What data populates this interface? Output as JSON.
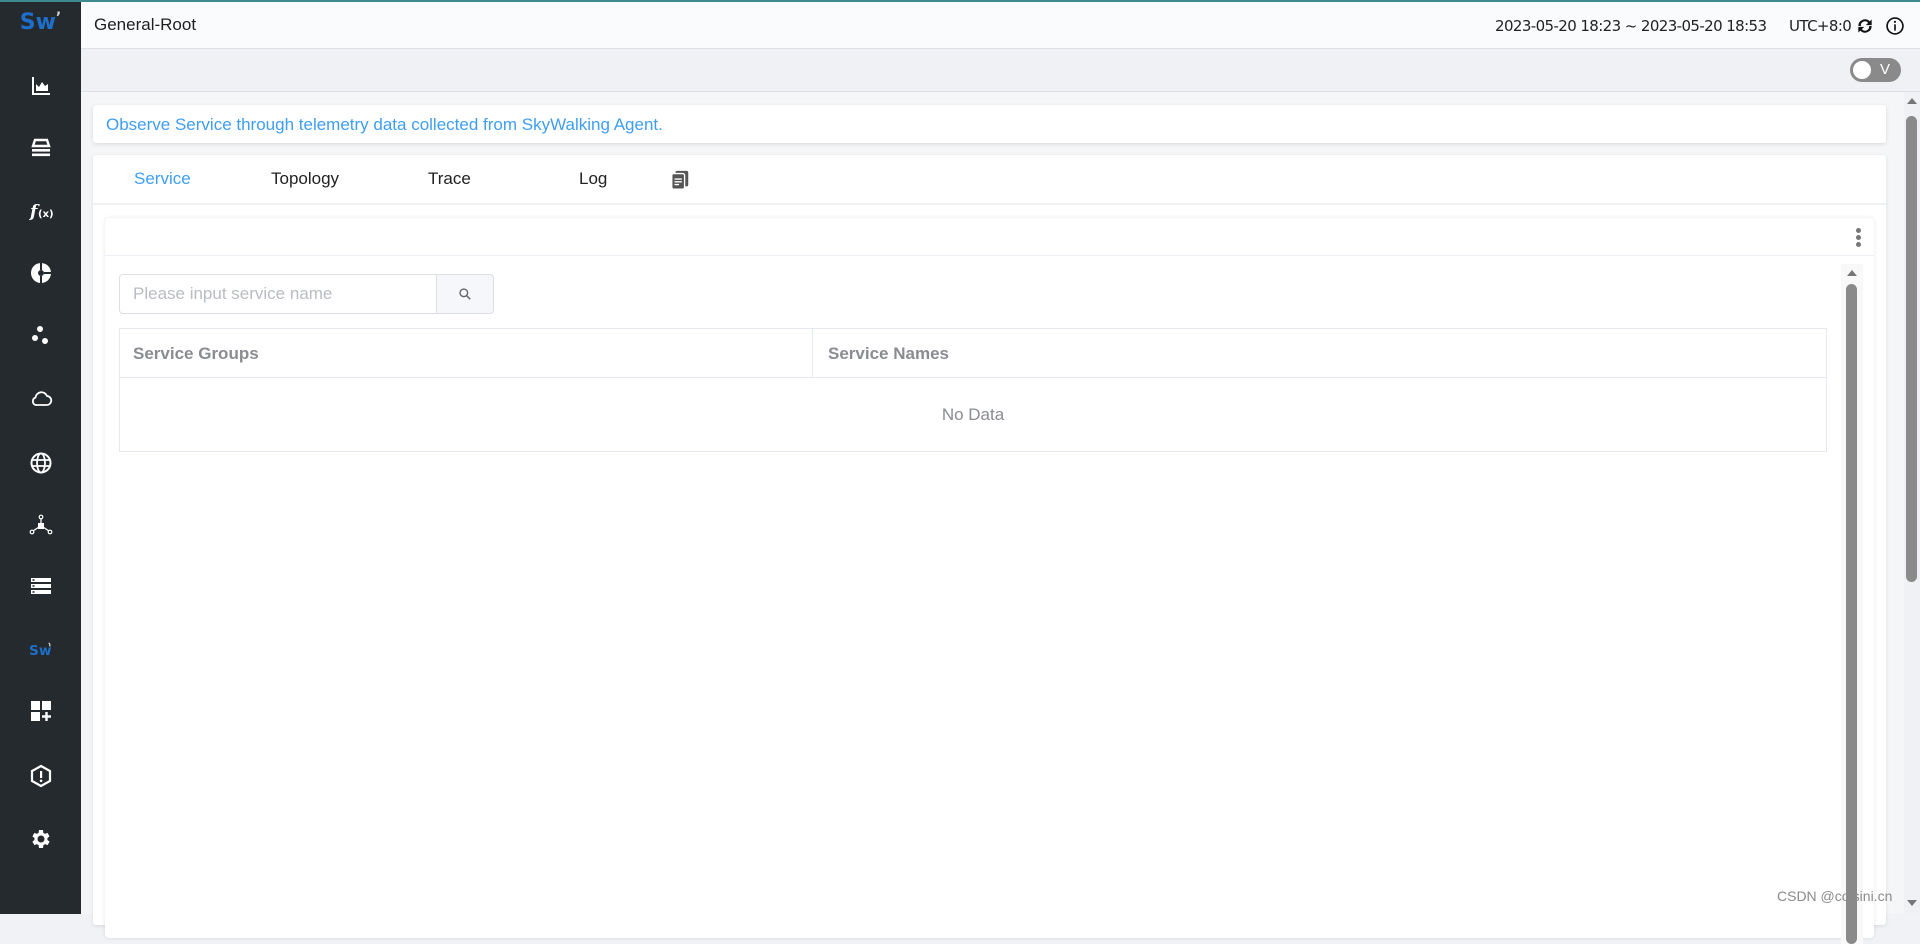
{
  "app": {
    "logo_text": "Sw",
    "accent_color": "#3e9ef5",
    "sidebar_color": "#252a2f"
  },
  "sidebar": {
    "items": [
      {
        "name": "marketplace",
        "icon": "area-chart-icon"
      },
      {
        "name": "general-service",
        "icon": "layers-icon"
      },
      {
        "name": "functions",
        "icon": "function-icon"
      },
      {
        "name": "service-mesh",
        "icon": "pie-chart-icon"
      },
      {
        "name": "kubernetes",
        "icon": "dots-icon"
      },
      {
        "name": "infrastructure",
        "icon": "cloud-icon"
      },
      {
        "name": "browser",
        "icon": "globe-icon"
      },
      {
        "name": "gateway",
        "icon": "network-node-icon"
      },
      {
        "name": "database",
        "icon": "server-list-icon"
      },
      {
        "name": "self-observability",
        "icon": "skywalking-logo-icon"
      },
      {
        "name": "dashboards",
        "icon": "add-widget-icon"
      },
      {
        "name": "alerting",
        "icon": "alert-hexagon-icon"
      },
      {
        "name": "settings",
        "icon": "gear-icon"
      }
    ]
  },
  "header": {
    "title": "General-Root",
    "time_range": "2023-05-20 18:23 ~ 2023-05-20 18:53",
    "timezone": "UTC+8:0",
    "refresh_icon": "refresh-icon",
    "info_icon": "info-icon"
  },
  "subbar": {
    "toggle_label": "V",
    "toggle_on": false
  },
  "info": {
    "text": "Observe Service through telemetry data collected from SkyWalking Agent."
  },
  "tabs": [
    {
      "label": "Service",
      "active": true
    },
    {
      "label": "Topology",
      "active": false
    },
    {
      "label": "Trace",
      "active": false
    },
    {
      "label": "Log",
      "active": false
    }
  ],
  "panel": {
    "search": {
      "value": "",
      "placeholder": "Please input service name"
    },
    "table": {
      "columns": [
        "Service Groups",
        "Service Names"
      ],
      "rows": [],
      "empty_text": "No Data"
    }
  },
  "watermark": "CSDN @coisini.cn"
}
